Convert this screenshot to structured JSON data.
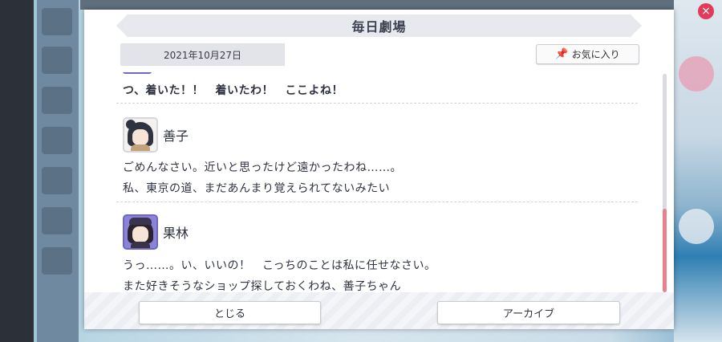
{
  "dialog": {
    "title": "毎日劇場",
    "date": "2021年10月27日",
    "favorite_label": "お気に入り",
    "favorite_icon": "pin-icon"
  },
  "transcript": {
    "top_line": "つ、着いた！！　着いたわ！　ここよね！",
    "entries": [
      {
        "speaker": "善子",
        "lines": [
          "ごめんなさい。近いと思ったけど遠かったわね……。",
          "私、東京の道、まだあんまり覚えられてないみたい"
        ]
      },
      {
        "speaker": "果林",
        "lines": [
          "うっ……。い、いいの！　こっちのことは私に任せなさい。",
          "また好きそうなショップ探しておくわね、善子ちゃん"
        ]
      }
    ]
  },
  "buttons": {
    "close_label": "とじる",
    "archive_label": "アーカイブ"
  },
  "colors": {
    "scroll_thumb": "#e8808d",
    "avatar_highlight": "#6d66c6",
    "close_badge": "#e23b5a"
  }
}
